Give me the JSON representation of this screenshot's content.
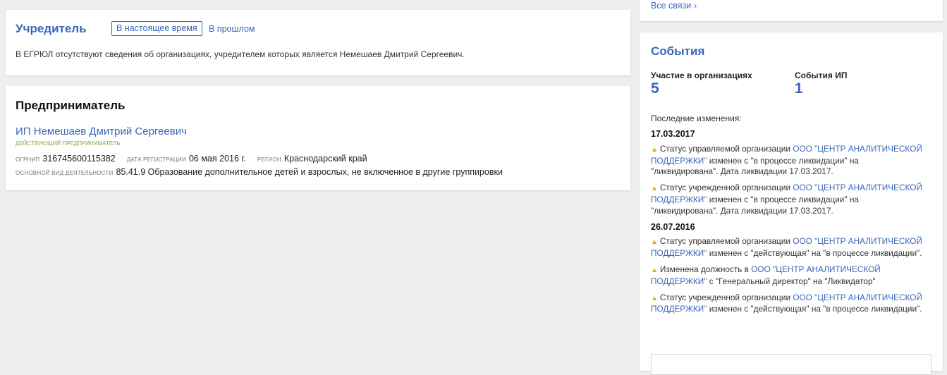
{
  "founder": {
    "title": "Учредитель",
    "tab_now": "В настоящее время",
    "tab_past": "В прошлом",
    "info": "В ЕГРЮЛ отсутствуют сведения об организациях, учредителем которых является Немешаев Дмитрий Сергеевич."
  },
  "entrepreneur": {
    "title": "Предприниматель",
    "name": "ИП Немешаев Дмитрий Сергеевич",
    "status": "действующий предприниматель",
    "ogrnip_label": "огрнип",
    "ogrnip": "316745600115382",
    "reg_date_label": "дата регистрации",
    "reg_date": "06 мая 2016 г.",
    "region_label": "регион",
    "region": "Краснодарский край",
    "activity_label": "основной вид деятельности",
    "activity": "85.41.9 Образование дополнительное детей и взрослых, не включенное в другие группировки"
  },
  "links": {
    "all_label": "Все связи",
    "chevron": "›"
  },
  "events": {
    "title": "События",
    "stat1_label": "Участие в организациях",
    "stat1_value": "5",
    "stat2_label": "События ИП",
    "stat2_value": "1",
    "last_changes_label": "Последние изменения:",
    "date1": "17.03.2017",
    "date2": "26.07.2016",
    "org_link": "ООО \"ЦЕНТР АНАЛИТИЧЕСКОЙ ПОДДЕРЖКИ\"",
    "i1_pre": "Статус управляемой организации",
    "i1_post": "изменен с \"в процессе ликвидации\" на \"ликвидирована\". Дата ликвидации 17.03.2017.",
    "i2_pre": "Статус учрежденной организации",
    "i2_post": "изменен с \"в процессе ликвидации\" на \"ликвидирована\". Дата ликвидации 17.03.2017.",
    "i3_pre": "Статус управляемой организации",
    "i3_post": "изменен с \"действующая\" на \"в процессе ликвидации\".",
    "i4_pre": "Изменена должность в",
    "i4_post": "с \"Генеральный директор\" на \"Ликвидатор\"",
    "i5_pre": "Статус учрежденной организации",
    "i5_post": "изменен с \"действующая\" на \"в процессе ликвидации\".",
    "warn_glyph": "▲",
    "warn_color": "#e6a817"
  },
  "colors": {
    "accent": "#3a66b8",
    "status_green": "#7aa84a",
    "background": "#efefef"
  }
}
